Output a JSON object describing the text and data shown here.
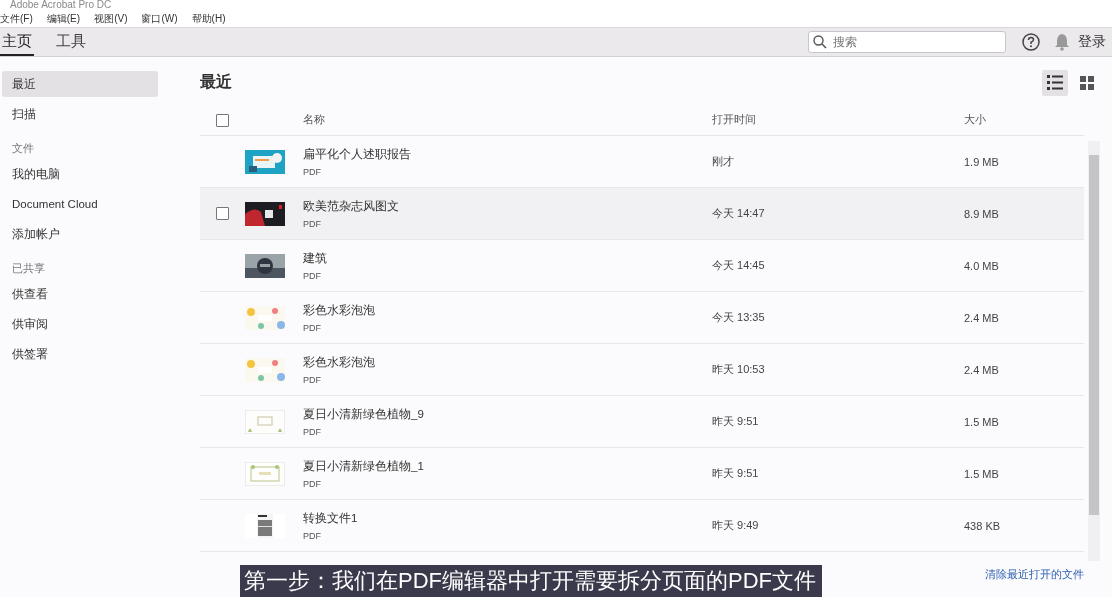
{
  "window": {
    "title": "Adobe Acrobat Pro DC"
  },
  "menu": [
    "文件(F)",
    "编辑(E)",
    "视图(V)",
    "窗口(W)",
    "帮助(H)"
  ],
  "tabs": [
    {
      "label": "主页",
      "selected": true
    },
    {
      "label": "工具",
      "selected": false
    }
  ],
  "search": {
    "placeholder": "搜索"
  },
  "login": "登录",
  "sidebar": [
    {
      "kind": "item",
      "label": "最近",
      "selected": true
    },
    {
      "kind": "item",
      "label": "扫描",
      "selected": false
    },
    {
      "kind": "heading",
      "label": "文件"
    },
    {
      "kind": "item",
      "label": "我的电脑",
      "selected": false
    },
    {
      "kind": "item",
      "label": "Document Cloud",
      "selected": false
    },
    {
      "kind": "item",
      "label": "添加帐户",
      "selected": false
    },
    {
      "kind": "heading",
      "label": "已共享"
    },
    {
      "kind": "item",
      "label": "供查看",
      "selected": false
    },
    {
      "kind": "item",
      "label": "供审阅",
      "selected": false
    },
    {
      "kind": "item",
      "label": "供签署",
      "selected": false
    }
  ],
  "heading": "最近",
  "views": [
    {
      "kind": "list",
      "selected": true
    },
    {
      "kind": "grid",
      "selected": false
    }
  ],
  "table": {
    "select_all_checked": false,
    "columns": [
      "名称",
      "打开时间",
      "大小"
    ],
    "rows": [
      {
        "name": "扁平化个人述职报告",
        "type": "PDF",
        "opened": "刚才",
        "size": "1.9 MB",
        "hovered": false
      },
      {
        "name": "欧美范杂志风图文",
        "type": "PDF",
        "opened": "今天 14:47",
        "size": "8.9 MB",
        "hovered": true,
        "checked": false
      },
      {
        "name": "建筑",
        "type": "PDF",
        "opened": "今天 14:45",
        "size": "4.0 MB",
        "hovered": false
      },
      {
        "name": "彩色水彩泡泡",
        "type": "PDF",
        "opened": "今天 13:35",
        "size": "2.4 MB",
        "hovered": false
      },
      {
        "name": "彩色水彩泡泡",
        "type": "PDF",
        "opened": "昨天 10:53",
        "size": "2.4 MB",
        "hovered": false
      },
      {
        "name": "夏日小清新绿色植物_9",
        "type": "PDF",
        "opened": "昨天 9:51",
        "size": "1.5 MB",
        "hovered": false
      },
      {
        "name": "夏日小清新绿色植物_1",
        "type": "PDF",
        "opened": "昨天 9:51",
        "size": "1.5 MB",
        "hovered": false
      },
      {
        "name": "转换文件1",
        "type": "PDF",
        "opened": "昨天 9:49",
        "size": "438 KB",
        "hovered": false
      }
    ]
  },
  "clear_link": "清除最近打开的文件",
  "caption": "第一步：我们在PDF编辑器中打开需要拆分页面的PDF文件"
}
